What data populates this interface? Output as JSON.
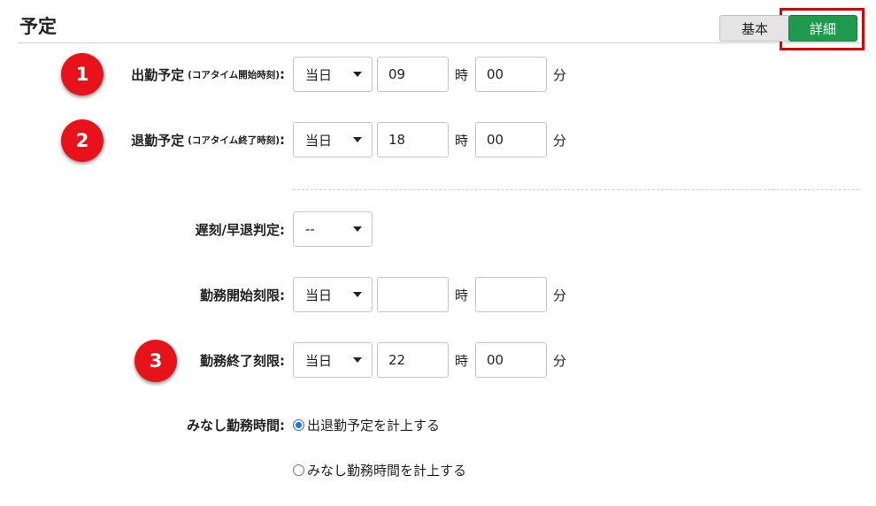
{
  "page": {
    "title": "予定"
  },
  "mode": {
    "basic": "基本",
    "detail": "詳細"
  },
  "markers": [
    "1",
    "2",
    "3"
  ],
  "units": {
    "hour": "時",
    "minute": "分"
  },
  "rows": {
    "start": {
      "label": "出勤予定",
      "sub": "(コアタイム開始時刻)",
      "colon": ":",
      "day": "当日",
      "hour": "09",
      "minute": "00"
    },
    "end": {
      "label": "退勤予定",
      "sub": "(コアタイム終了時刻)",
      "colon": ":",
      "day": "当日",
      "hour": "18",
      "minute": "00"
    },
    "late": {
      "label": "遅刻/早退判定:",
      "value": "--"
    },
    "work_start_limit": {
      "label": "勤務開始刻限:",
      "day": "当日",
      "hour": "",
      "minute": ""
    },
    "work_end_limit": {
      "label": "勤務終了刻限:",
      "day": "当日",
      "hour": "22",
      "minute": "00"
    }
  },
  "deemed": {
    "label": "みなし勤務時間:",
    "options": [
      {
        "label": "出退勤予定を計上する",
        "selected": true
      },
      {
        "label": "みなし勤務時間を計上する",
        "selected": false
      }
    ]
  },
  "colors": {
    "accent_green": "#1f9a4d",
    "marker_red": "#e8121b",
    "highlight_red": "#e00000"
  }
}
